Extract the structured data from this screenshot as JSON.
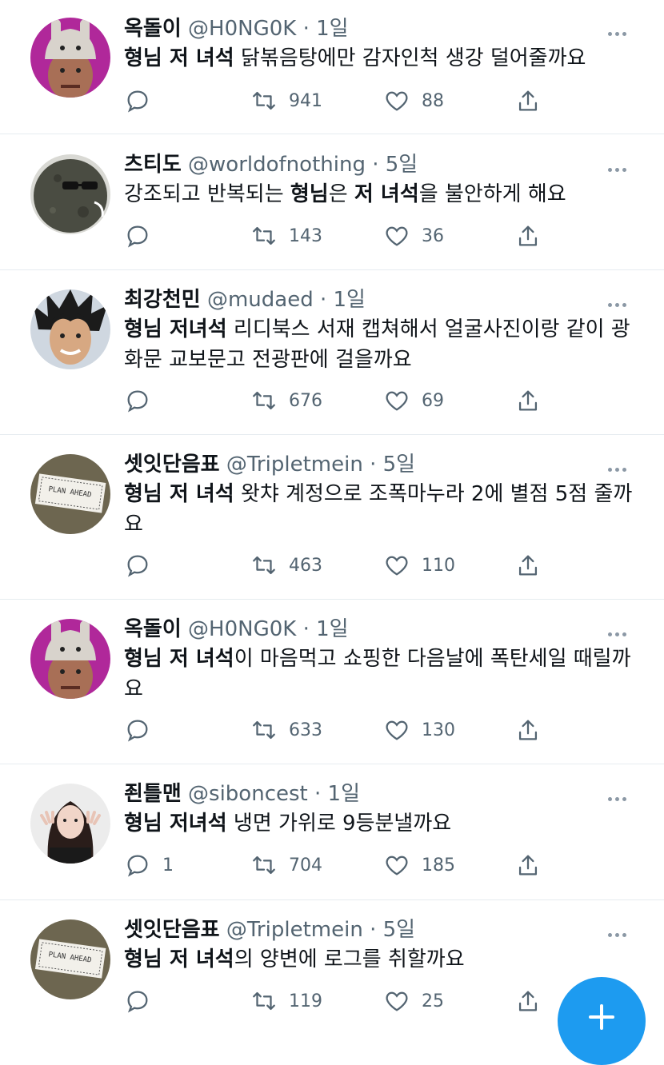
{
  "colors": {
    "accent": "#1d9bf0",
    "secondary_text": "#536471",
    "divider": "#e6ecf0"
  },
  "tweets": [
    {
      "name": "옥돌이",
      "handle": "@H0NG0K",
      "time": "1일",
      "bold": "형님 저 녀석",
      "text": " 닭볶음탕에만 감자인척 생강 덜어줄까요",
      "avatar": "bunny-hat-man",
      "reply": "",
      "retweet": "941",
      "like": "88"
    },
    {
      "name": "츠티도",
      "handle": "@worldofnothing",
      "time": "5일",
      "pre": "강조되고 반복되는 ",
      "bold": "형님",
      "mid": "은 ",
      "bold2": "저 녀석",
      "text": "을 불안하게 해요",
      "avatar": "rock-with-sunglasses",
      "reply": "",
      "retweet": "143",
      "like": "36"
    },
    {
      "name": "최강천민",
      "handle": "@mudaed",
      "time": "1일",
      "bold": "형님 저녀석",
      "text": " 리디북스 서재 캡쳐해서 얼굴사진이랑 같이 광화문 교보문고 전광판에 걸을까요",
      "avatar": "spiky-hair-man",
      "reply": "",
      "retweet": "676",
      "like": "69"
    },
    {
      "name": "셋잇단음표",
      "handle": "@Tripletmein",
      "time": "5일",
      "bold": "형님 저 녀석",
      "text": " 왓챠 계정으로 조폭마누라 2에 별점 5점 줄까요",
      "avatar": "plan-ahead-sign",
      "reply": "",
      "retweet": "463",
      "like": "110"
    },
    {
      "name": "옥돌이",
      "handle": "@H0NG0K",
      "time": "1일",
      "bold": "형님 저 녀석",
      "text": "이 마음먹고 쇼핑한 다음날에 폭탄세일 때릴까요",
      "avatar": "bunny-hat-man",
      "reply": "",
      "retweet": "633",
      "like": "130"
    },
    {
      "name": "죈틀맨",
      "handle": "@siboncest",
      "time": "1일",
      "bold": "형님 저녀석",
      "text": " 냉면 가위로 9등분낼까요",
      "avatar": "claw-pose-girl",
      "reply": "1",
      "retweet": "704",
      "like": "185"
    },
    {
      "name": "셋잇단음표",
      "handle": "@Tripletmein",
      "time": "5일",
      "bold": "형님 저 녀석",
      "text": "의 양변에 로그를 취할까요",
      "avatar": "plan-ahead-sign",
      "reply": "",
      "retweet": "119",
      "like": "25"
    }
  ],
  "sign_text": "PLAN AHEAD",
  "fab": {
    "icon": "plus-icon"
  }
}
